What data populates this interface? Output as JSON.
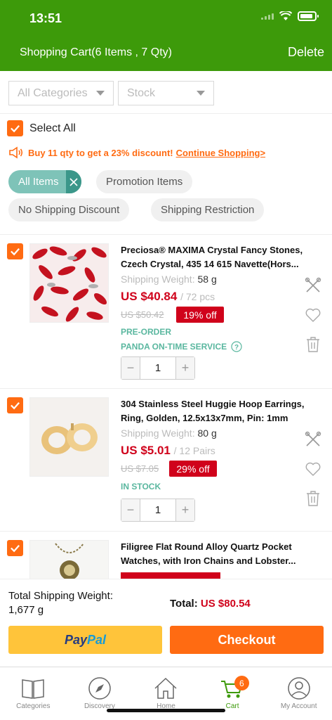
{
  "status_bar": {
    "time": "13:51"
  },
  "header": {
    "title": "Shopping Cart(6 Items , 7 Qty)",
    "delete_label": "Delete"
  },
  "filters": {
    "categories": "All Categories",
    "stock": "Stock"
  },
  "select_all_label": "Select All",
  "promo": {
    "text": "Buy 11 qty to get a 23% discount!",
    "link": "Continue Shopping>"
  },
  "chips": [
    "All Items",
    "Promotion Items",
    "No Shipping Discount",
    "Shipping Restriction"
  ],
  "products": [
    {
      "name": "Preciosa® MAXIMA Crystal Fancy Stones, Czech Crystal, 435 14 615 Navette(Hors...",
      "weight_label": "Shipping Weight:",
      "weight": "58 g",
      "price": "US $40.84",
      "unit": "/ 72 pcs",
      "original_price": "US $50.42",
      "discount": "19% off",
      "status": "PRE-ORDER",
      "service": "PANDA ON-TIME SERVICE",
      "qty": "1"
    },
    {
      "name": "304 Stainless Steel Huggie Hoop Earrings, Ring, Golden, 12.5x13x7mm, Pin: 1mm",
      "weight_label": "Shipping Weight:",
      "weight": "80 g",
      "price": "US $5.01",
      "unit": "/ 12 Pairs",
      "original_price": "US $7.05",
      "discount": "29% off",
      "status": "IN STOCK",
      "qty": "1"
    },
    {
      "name": "Filigree Flat Round Alloy Quartz Pocket Watches, with Iron Chains and Lobster..."
    }
  ],
  "summary": {
    "weight_label": "Total Shipping Weight:",
    "weight_value": "1,677 g",
    "total_label": "Total:",
    "total_value": "US $80.54",
    "paypal_a": "Pay",
    "paypal_b": "Pal",
    "checkout_label": "Checkout"
  },
  "tabs": [
    "Categories",
    "Discovery",
    "Home",
    "Cart",
    "My Account"
  ],
  "cart_badge": "6",
  "colors": {
    "brand_green": "#3d9a0a",
    "accent_orange": "#ff6b12",
    "price_red": "#d0021b",
    "teal": "#5ab79f"
  }
}
